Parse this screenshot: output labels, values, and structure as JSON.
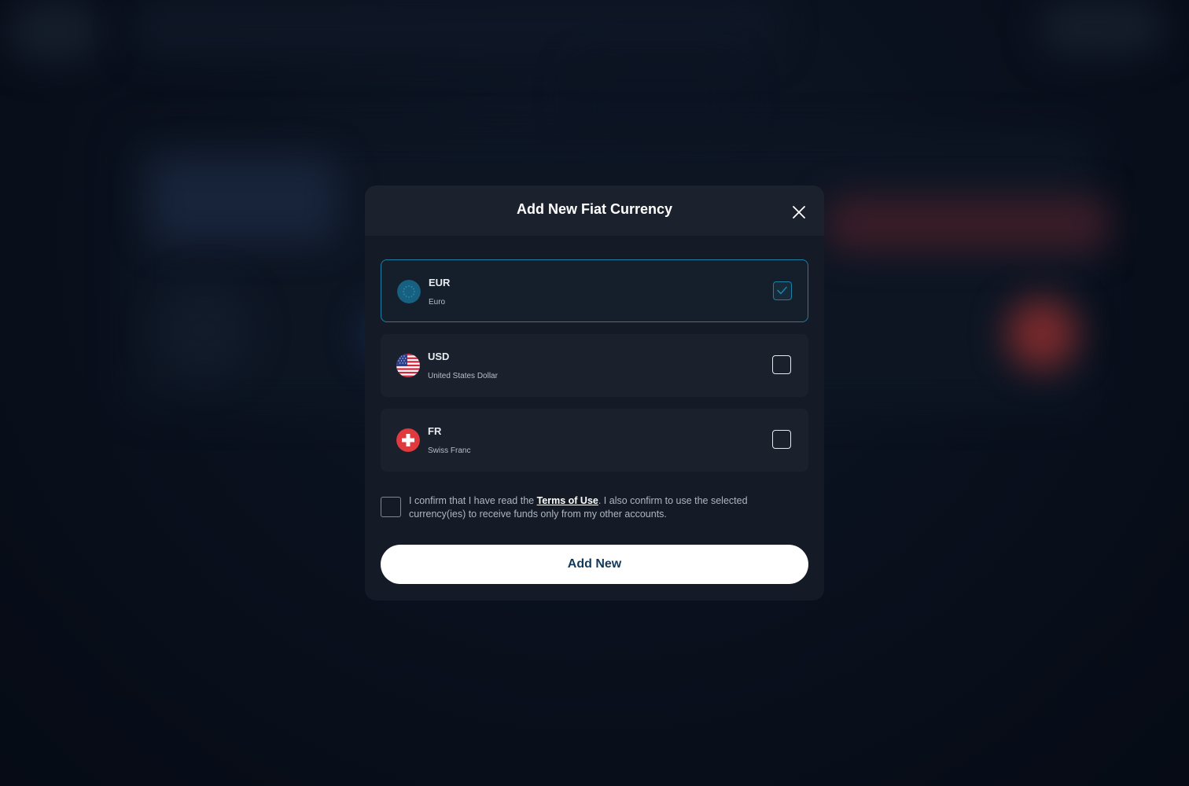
{
  "modal": {
    "title": "Add New Fiat Currency",
    "close_icon": "close-icon"
  },
  "currencies": [
    {
      "code": "EUR",
      "name": "Euro",
      "flag_icon": "eu-flag-icon",
      "checked": true
    },
    {
      "code": "USD",
      "name": "United States Dollar",
      "flag_icon": "us-flag-icon",
      "checked": false
    },
    {
      "code": "FR",
      "name": "Swiss Franc",
      "flag_icon": "swiss-flag-icon",
      "checked": false
    }
  ],
  "terms": {
    "text_before": "I confirm that I have read the ",
    "link_label": "Terms of Use",
    "text_after": ". I also confirm to use the selected currency(ies) to receive funds only from my other accounts.",
    "checked": false
  },
  "actions": {
    "add_label": "Add New"
  },
  "colors": {
    "accent": "#1c7fa6",
    "button_text": "#12395a",
    "modal_bg": "#141b26"
  }
}
